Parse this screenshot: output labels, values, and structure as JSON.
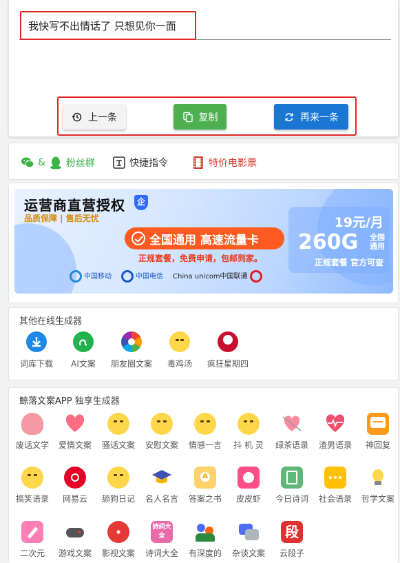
{
  "editor": {
    "text": "我快写不出情话了 只想见你一面"
  },
  "buttons": {
    "prev": "上一条",
    "copy": "复制",
    "next": "再来一条"
  },
  "links": {
    "wechat_amp": "&",
    "fans": "粉丝群",
    "shortcut": "快捷指令",
    "movie": "特价电影票"
  },
  "banner": {
    "title": "运营商直营授权",
    "shield": "企",
    "sub": "品质保障 | 售后无忧",
    "pill": "全国通用 高速流量卡",
    "red_line": "正规套餐，免费申请，包邮到家。",
    "price": "19元/月",
    "gb": "260G",
    "gb_sub1": "全国",
    "gb_sub2": "通用",
    "official": "正规套餐 官方可查",
    "logos": [
      "中国移动",
      "中国电信",
      "China unicom中国联通"
    ]
  },
  "other_generators": {
    "title": "其他在线生成器",
    "items": [
      {
        "label": "词库下载",
        "icon": "download-icon"
      },
      {
        "label": "AI文案",
        "icon": "ai-icon"
      },
      {
        "label": "朋友圈文案",
        "icon": "camera-aperture-icon"
      },
      {
        "label": "毒鸡汤",
        "icon": "dizzy-face-icon"
      },
      {
        "label": "疯狂星期四",
        "icon": "kfc-icon"
      }
    ]
  },
  "app_section": {
    "title": "鲸落文案APP",
    "title_suffix": "独享生成器",
    "rows": [
      [
        "废话文学",
        "爱情文案",
        "骚话文案",
        "安慰文案",
        "情感一言",
        "抖 机 灵",
        "绿茶语录",
        "渣男语录",
        "神回复"
      ],
      [
        "搞笑语录",
        "网易云",
        "舔狗日记",
        "名人名言",
        "答案之书",
        "皮皮虾",
        "今日诗词",
        "社会语录",
        "哲学文案"
      ],
      [
        "二次元",
        "游戏文案",
        "影视文案",
        "诗词大全",
        "有深度的",
        "杂谈文案",
        "云段子"
      ]
    ],
    "badge_shici": "詩詞大全",
    "badge_duan": "段"
  },
  "colors": {
    "green": "#4caf50",
    "blue": "#1976d2",
    "red_border": "#e02525",
    "orange": "#ff5a1f"
  }
}
